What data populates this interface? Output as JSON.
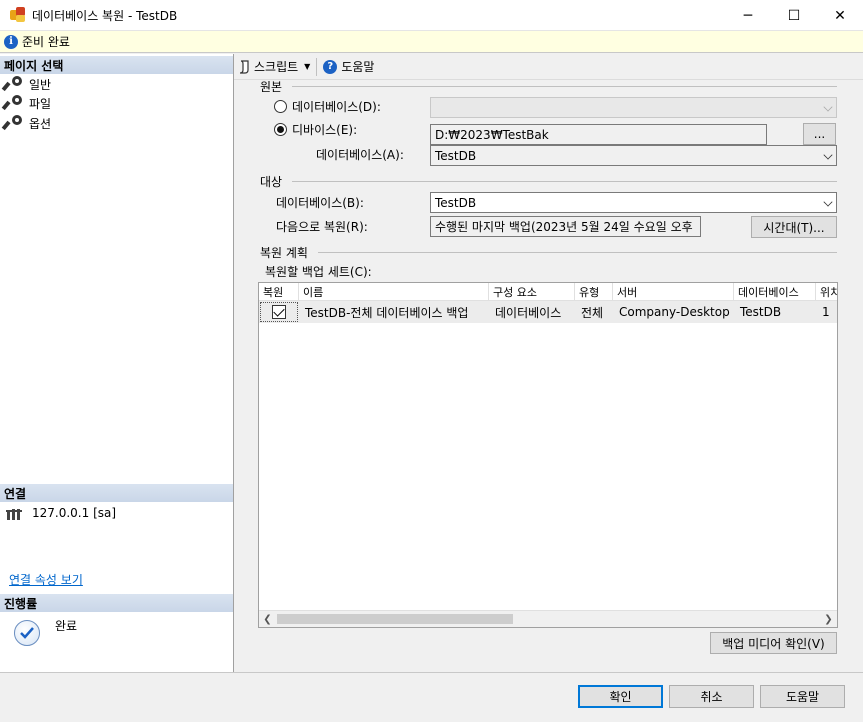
{
  "window": {
    "title": "데이터베이스 복원 - TestDB",
    "minimize": "─",
    "maximize": "☐",
    "close": "✕"
  },
  "status": {
    "text": "준비 완료"
  },
  "left": {
    "page_select_header": "페이지 선택",
    "pages": [
      {
        "label": "일반"
      },
      {
        "label": "파일"
      },
      {
        "label": "옵션"
      }
    ],
    "connection_header": "연결",
    "connection_value": "127.0.0.1 [sa]",
    "connection_link": "연결 속성 보기",
    "progress_header": "진행률",
    "progress_status": "완료"
  },
  "toolbar": {
    "script_label": "스크립트",
    "help_label": "도움말"
  },
  "source": {
    "group_label": "원본",
    "database_radio": "데이터베이스(D):",
    "device_radio": "디바이스(E):",
    "device_path": "D:₩2023₩TestBak",
    "browse_label": "...",
    "database_label": "데이터베이스(A):",
    "database_value": "TestDB"
  },
  "destination": {
    "group_label": "대상",
    "database_label": "데이터베이스(B):",
    "database_value": "TestDB",
    "restore_to_label": "다음으로 복원(R):",
    "restore_to_value": "수행된 마지막 백업(2023년 5월 24일 수요일 오후",
    "timeline_button": "시간대(T)..."
  },
  "plan": {
    "group_label": "복원 계획",
    "backup_sets_label": "복원할 백업 세트(C):",
    "columns": [
      "복원",
      "이름",
      "구성 요소",
      "유형",
      "서버",
      "데이터베이스",
      "위치"
    ],
    "rows": [
      {
        "restore": true,
        "name": "TestDB-전체 데이터베이스 백업",
        "component": "데이터베이스",
        "type": "전체",
        "server": "Company-Desktop",
        "database": "TestDB",
        "position": "1"
      }
    ],
    "verify_button": "백업 미디어 확인(V)"
  },
  "footer": {
    "ok": "확인",
    "cancel": "취소",
    "help": "도움말"
  }
}
